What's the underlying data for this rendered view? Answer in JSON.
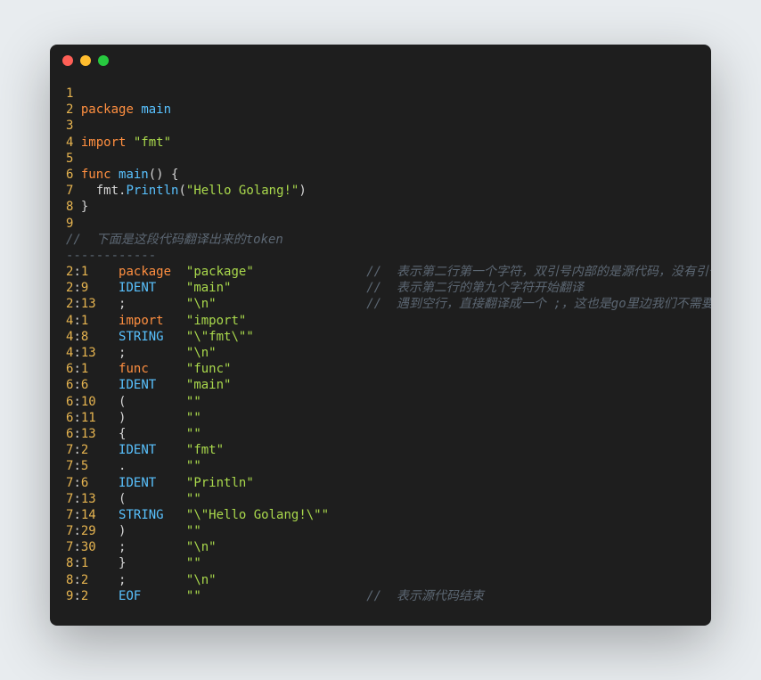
{
  "window": {
    "dots": [
      "red",
      "yellow",
      "green"
    ]
  },
  "source": {
    "lines": [
      {
        "num": "1",
        "segs": []
      },
      {
        "num": "2",
        "segs": [
          {
            "cls": "kw-package",
            "t": "package"
          },
          {
            "cls": "ident-main",
            "t": " main"
          }
        ]
      },
      {
        "num": "3",
        "segs": []
      },
      {
        "num": "4",
        "segs": [
          {
            "cls": "kw-import",
            "t": "import"
          },
          {
            "cls": "string",
            "t": " \"fmt\""
          }
        ]
      },
      {
        "num": "5",
        "segs": []
      },
      {
        "num": "6",
        "segs": [
          {
            "cls": "kw-func",
            "t": "func"
          },
          {
            "cls": "ident-main",
            "t": " main"
          },
          {
            "cls": "paren",
            "t": "()"
          },
          {
            "cls": "brace",
            "t": " {"
          }
        ]
      },
      {
        "num": "7",
        "segs": [
          {
            "cls": "ident-fmt",
            "t": "  fmt"
          },
          {
            "cls": "dot-sep",
            "t": "."
          },
          {
            "cls": "ident-println",
            "t": "Println"
          },
          {
            "cls": "paren",
            "t": "("
          },
          {
            "cls": "string",
            "t": "\"Hello Golang!\""
          },
          {
            "cls": "paren",
            "t": ")"
          }
        ]
      },
      {
        "num": "8",
        "segs": [
          {
            "cls": "brace",
            "t": "}"
          }
        ]
      },
      {
        "num": "9",
        "segs": []
      }
    ]
  },
  "header_comment": "//  下面是这段代码翻译出来的token",
  "divider": "------------",
  "tokens": [
    {
      "line": "2",
      "col": "1",
      "type": "package",
      "typeCls": "tok-type-kw",
      "val": "\"package\"",
      "comment": "//  表示第二行第一个字符，双引号内部的是源代码，没有引号的是翻译的token"
    },
    {
      "line": "2",
      "col": "9",
      "type": "IDENT",
      "typeCls": "tok-type",
      "val": "\"main\"",
      "comment": "//  表示第二行的第九个字符开始翻译"
    },
    {
      "line": "2",
      "col": "13",
      "type": ";",
      "typeCls": "tok-punct",
      "val": "\"\\n\"",
      "comment": "//  遇到空行，直接翻译成一个 ;，这也是go里边我们不需要; 的原因"
    },
    {
      "line": "4",
      "col": "1",
      "type": "import",
      "typeCls": "tok-type-kw",
      "val": "\"import\"",
      "comment": ""
    },
    {
      "line": "4",
      "col": "8",
      "type": "STRING",
      "typeCls": "tok-type",
      "val": "\"\\\"fmt\\\"\"",
      "comment": ""
    },
    {
      "line": "4",
      "col": "13",
      "type": ";",
      "typeCls": "tok-punct",
      "val": "\"\\n\"",
      "comment": ""
    },
    {
      "line": "6",
      "col": "1",
      "type": "func",
      "typeCls": "tok-type-kw",
      "val": "\"func\"",
      "comment": ""
    },
    {
      "line": "6",
      "col": "6",
      "type": "IDENT",
      "typeCls": "tok-type",
      "val": "\"main\"",
      "comment": ""
    },
    {
      "line": "6",
      "col": "10",
      "type": "(",
      "typeCls": "tok-punct",
      "val": "\"\"",
      "comment": ""
    },
    {
      "line": "6",
      "col": "11",
      "type": ")",
      "typeCls": "tok-punct",
      "val": "\"\"",
      "comment": ""
    },
    {
      "line": "6",
      "col": "13",
      "type": "{",
      "typeCls": "tok-punct",
      "val": "\"\"",
      "comment": ""
    },
    {
      "line": "7",
      "col": "2",
      "type": "IDENT",
      "typeCls": "tok-type",
      "val": "\"fmt\"",
      "comment": ""
    },
    {
      "line": "7",
      "col": "5",
      "type": ".",
      "typeCls": "tok-punct",
      "val": "\"\"",
      "comment": ""
    },
    {
      "line": "7",
      "col": "6",
      "type": "IDENT",
      "typeCls": "tok-type",
      "val": "\"Println\"",
      "comment": ""
    },
    {
      "line": "7",
      "col": "13",
      "type": "(",
      "typeCls": "tok-punct",
      "val": "\"\"",
      "comment": ""
    },
    {
      "line": "7",
      "col": "14",
      "type": "STRING",
      "typeCls": "tok-type",
      "val": "\"\\\"Hello Golang!\\\"\"",
      "comment": ""
    },
    {
      "line": "7",
      "col": "29",
      "type": ")",
      "typeCls": "tok-punct",
      "val": "\"\"",
      "comment": ""
    },
    {
      "line": "7",
      "col": "30",
      "type": ";",
      "typeCls": "tok-punct",
      "val": "\"\\n\"",
      "comment": ""
    },
    {
      "line": "8",
      "col": "1",
      "type": "}",
      "typeCls": "tok-punct",
      "val": "\"\"",
      "comment": ""
    },
    {
      "line": "8",
      "col": "2",
      "type": ";",
      "typeCls": "tok-punct",
      "val": "\"\\n\"",
      "comment": ""
    },
    {
      "line": "9",
      "col": "2",
      "type": "EOF",
      "typeCls": "tok-type",
      "val": "\"\"",
      "comment": "//  表示源代码结束"
    }
  ]
}
